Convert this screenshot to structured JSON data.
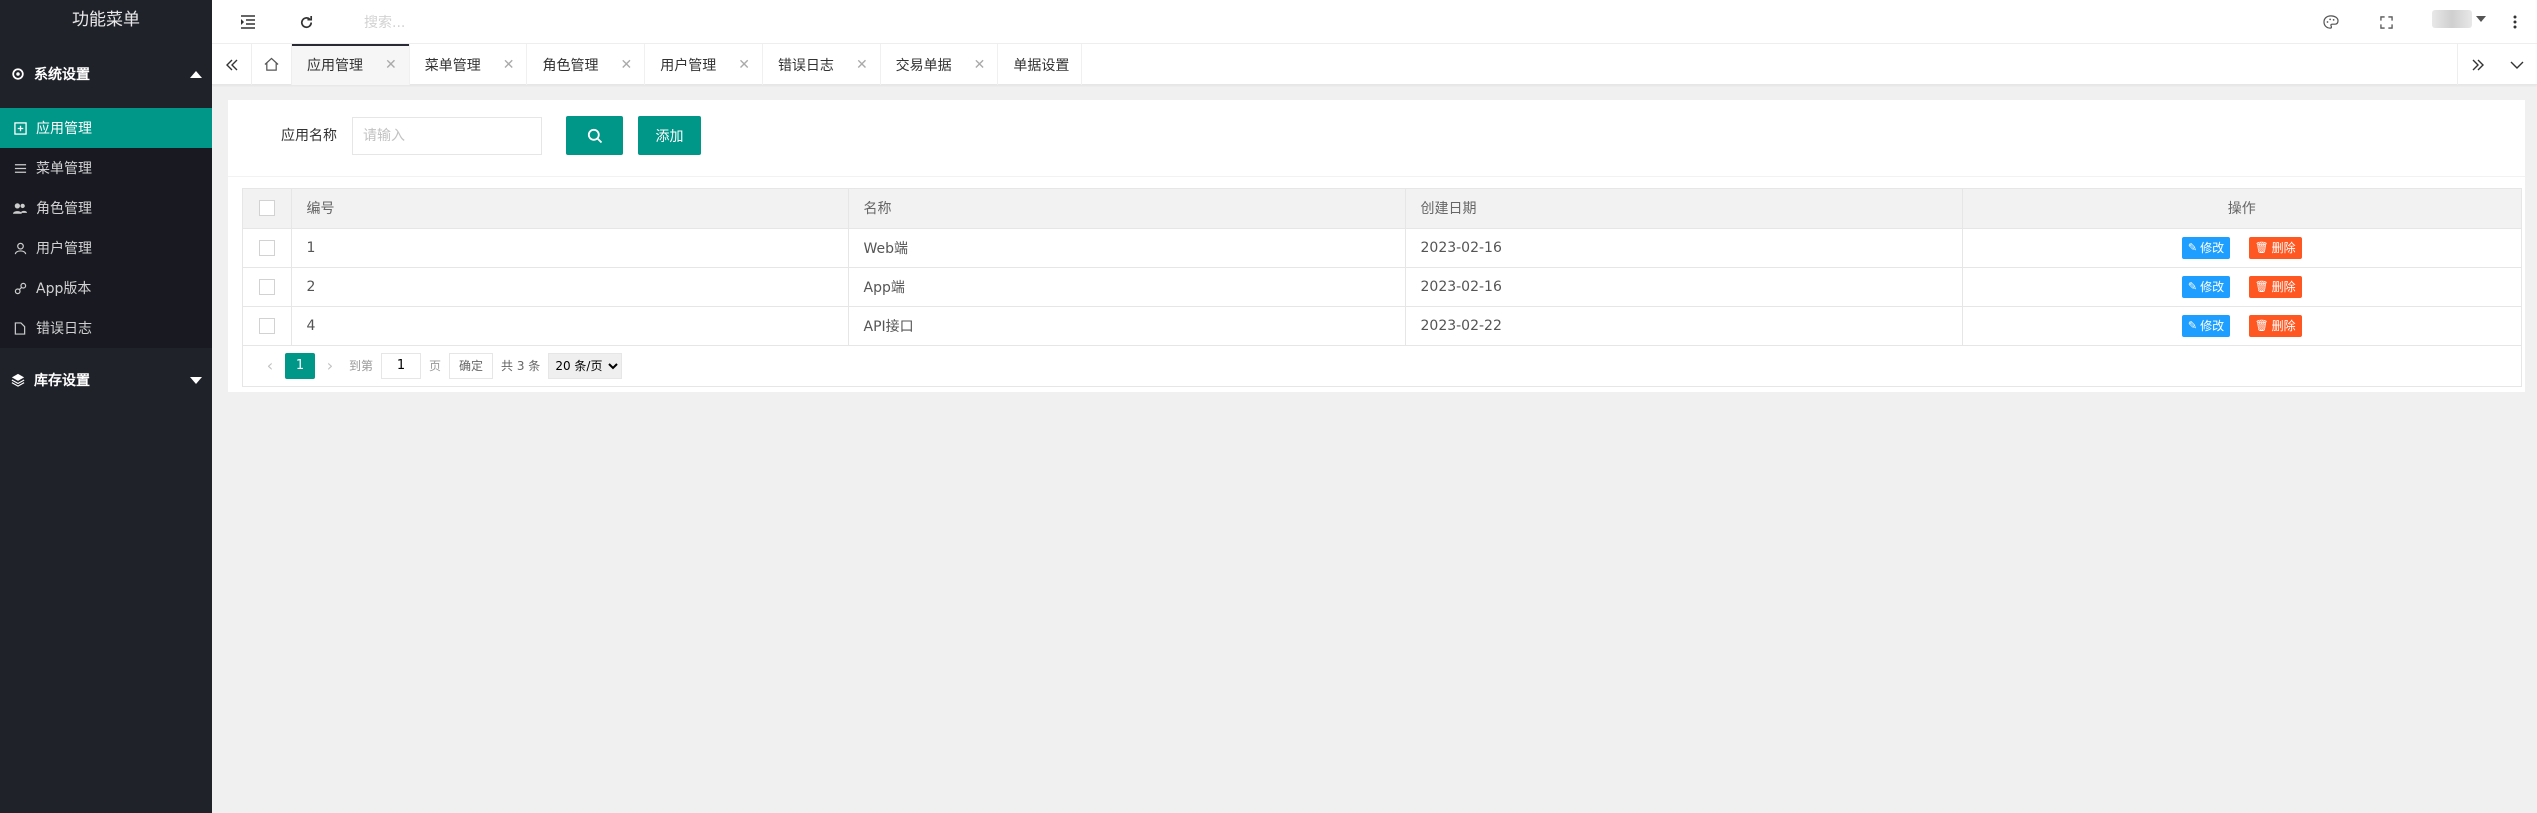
{
  "sidebar": {
    "title": "功能菜单",
    "groups": [
      {
        "label": "系统设置",
        "expanded": true,
        "items": [
          {
            "label": "应用管理",
            "active": true
          },
          {
            "label": "菜单管理"
          },
          {
            "label": "角色管理"
          },
          {
            "label": "用户管理"
          },
          {
            "label": "App版本"
          },
          {
            "label": "错误日志"
          }
        ]
      },
      {
        "label": "库存设置",
        "expanded": false
      }
    ]
  },
  "header": {
    "search_placeholder": "搜索..."
  },
  "tabs": [
    {
      "label": "应用管理",
      "active": true
    },
    {
      "label": "菜单管理"
    },
    {
      "label": "角色管理"
    },
    {
      "label": "用户管理"
    },
    {
      "label": "错误日志"
    },
    {
      "label": "交易单据"
    },
    {
      "label": "单据设置"
    }
  ],
  "form": {
    "name_label": "应用名称",
    "name_placeholder": "请输入",
    "add_label": "添加"
  },
  "table": {
    "headers": [
      "编号",
      "名称",
      "创建日期",
      "操作"
    ],
    "rows": [
      {
        "id": "1",
        "name": "Web端",
        "date": "2023-02-16"
      },
      {
        "id": "2",
        "name": "App端",
        "date": "2023-02-16"
      },
      {
        "id": "4",
        "name": "API接口",
        "date": "2023-02-22"
      }
    ],
    "edit_label": "修改",
    "delete_label": "删除"
  },
  "pager": {
    "current": "1",
    "goto_label": "到第",
    "goto_value": "1",
    "page_unit": "页",
    "confirm_label": "确定",
    "total_text": "共 3 条",
    "page_size": "20 条/页"
  },
  "colors": {
    "primary": "#009688",
    "sidebar_bg": "#20222a",
    "edit": "#1e9fff",
    "delete": "#ff5722"
  }
}
